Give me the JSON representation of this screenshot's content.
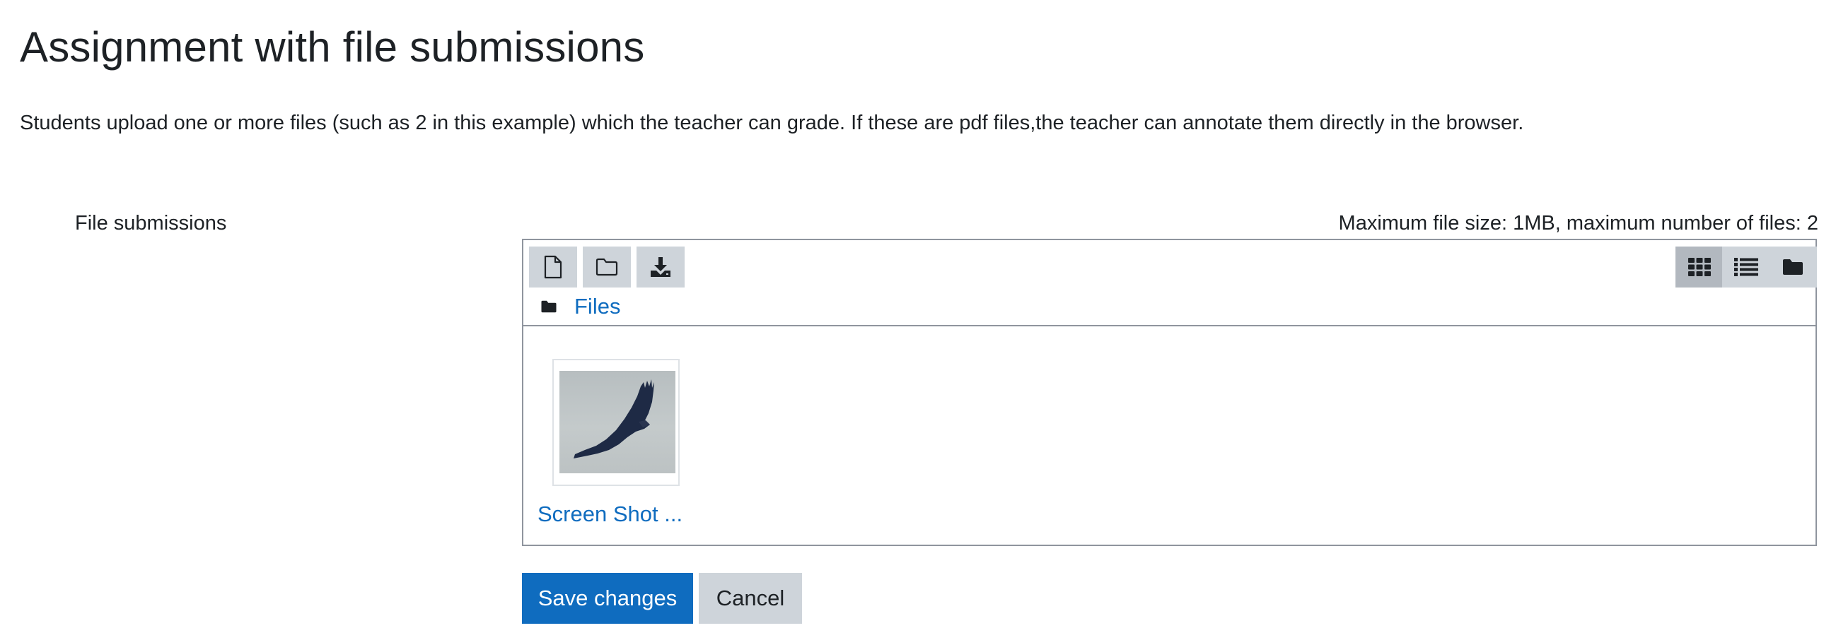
{
  "page": {
    "title": "Assignment with file submissions",
    "intro": "Students upload one or more files (such as 2 in this example) which the teacher can grade. If these are pdf files,the teacher can annotate them directly in the browser."
  },
  "form": {
    "field_label": "File submissions",
    "limits": "Maximum file size: 1MB, maximum number of files: 2"
  },
  "filemanager": {
    "toolbar": [
      {
        "name": "add-file-icon",
        "action": "Add file"
      },
      {
        "name": "create-folder-icon",
        "action": "Create folder"
      },
      {
        "name": "download-all-icon",
        "action": "Download all"
      }
    ],
    "view_modes": [
      {
        "name": "icons-view-icon",
        "active": true
      },
      {
        "name": "list-view-icon",
        "active": false
      },
      {
        "name": "tree-view-icon",
        "active": false
      }
    ],
    "breadcrumb": {
      "folder_icon": "folder-solid-icon",
      "label": "Files"
    },
    "files": [
      {
        "name": "Screen Shot ...",
        "thumbnail": "eagle-in-flight"
      }
    ]
  },
  "actions": {
    "save_label": "Save changes",
    "cancel_label": "Cancel"
  },
  "colors": {
    "link": "#0f6cbf",
    "primary_button": "#0f6cbf",
    "secondary_button": "#ced4da",
    "active_view": "#b2b8bf",
    "border": "#8f959e"
  }
}
